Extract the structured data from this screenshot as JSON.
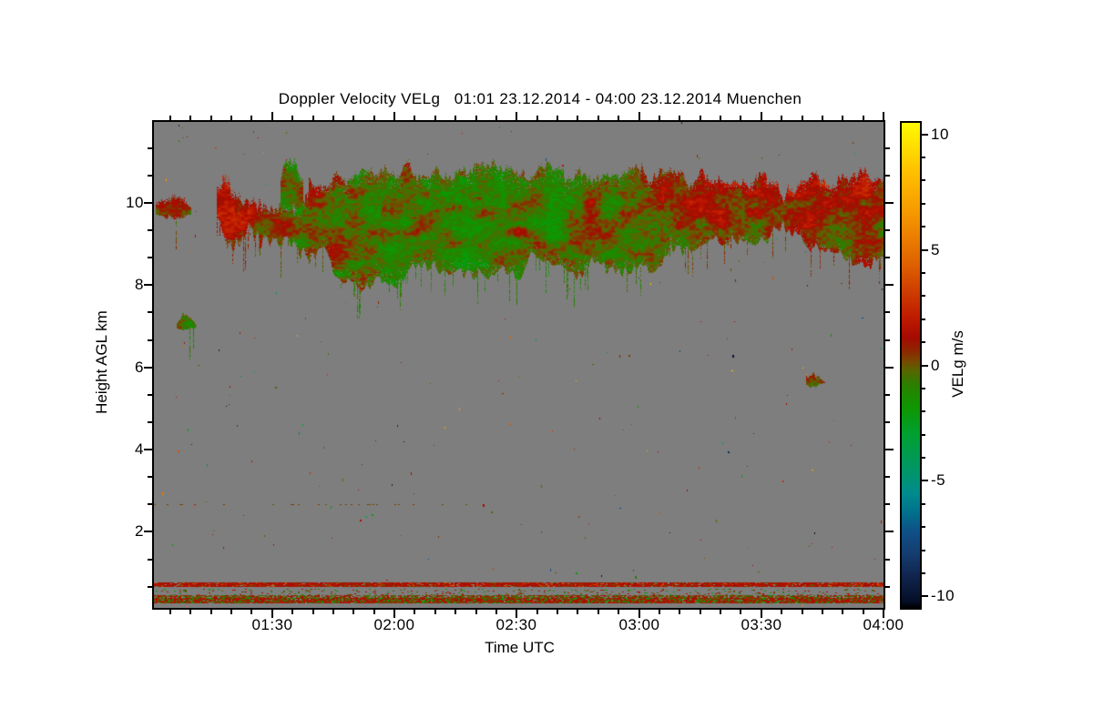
{
  "chart_data": {
    "type": "heatmap",
    "title": "Doppler Velocity VELg   01:01 23.12.2014 - 04:00 23.12.2014 Muenchen",
    "quantity": "Doppler Velocity VELg",
    "location": "Muenchen",
    "time_start": "01:01 23.12.2014",
    "time_end": "04:00 23.12.2014",
    "xlabel": "Time UTC",
    "ylabel": "Height AGL km",
    "colorbar_label": "VELg m/s",
    "x_tick_labels": [
      "01:30",
      "02:00",
      "02:30",
      "03:00",
      "03:30",
      "04:00"
    ],
    "x_tick_minutes": [
      29,
      59,
      89,
      119,
      149,
      179
    ],
    "x_minor_step_minutes": 5,
    "x_range_minutes": [
      0,
      179
    ],
    "y_tick_labels": [
      "2",
      "4",
      "6",
      "8",
      "10"
    ],
    "y_ticks_km": [
      2,
      4,
      6,
      8,
      10
    ],
    "y_minor_step_km": 0.6667,
    "ylim_km": [
      0.15,
      11.97
    ],
    "colorbar_tick_labels": [
      "10",
      "5",
      "0",
      "-5",
      "-10"
    ],
    "colorbar_ticks": [
      10,
      5,
      0,
      -5,
      -10
    ],
    "colorbar_minor_step": 1,
    "vlim_m_s": [
      -10.5,
      10.5
    ],
    "units": "m/s",
    "no_signal_color": "#7E7E7E",
    "features": [
      {
        "name": "cirrus-cloud-layer",
        "time": "01:15-04:00",
        "height_km": "8.0-11.2",
        "velocity_m_s": "-2 to +3",
        "description": "elevated cloud layer; mostly weak negative (green) Doppler velocities with olive/orange-brown patches of weak positive velocity; orange dominates after 03:10 and in the 01:20-01:45 patch"
      },
      {
        "name": "small-cloud-patch",
        "time": "01:06-01:12",
        "height_km": "6.9-7.2",
        "velocity_m_s": "about -1 (green)"
      },
      {
        "name": "small-cloud-patch",
        "time": "03:40-03:45",
        "height_km": "5.5-5.9",
        "velocity_m_s": "about -0.5 (olive-green)"
      },
      {
        "name": "near-surface-clutter-lines",
        "height_km": "0.28-0.78",
        "description": "speckled red/olive/green horizontal artifact lines spanning the full time range"
      },
      {
        "name": "faint-dotted-line",
        "height_km": "2.7",
        "time": "01:01-02:20",
        "description": "sparse olive dots"
      },
      {
        "name": "noise-speckles",
        "description": "isolated random colored pixels scattered over the no-signal gray background"
      }
    ],
    "render": {
      "seed": 7,
      "colormap": [
        [
          10.5,
          "#FFFA00"
        ],
        [
          8.5,
          "#FFC300"
        ],
        [
          6.5,
          "#F59600"
        ],
        [
          4.5,
          "#E06400"
        ],
        [
          3.0,
          "#CC3700"
        ],
        [
          2.0,
          "#BE1900"
        ],
        [
          1.2,
          "#A50A00"
        ],
        [
          0.6,
          "#8C2800"
        ],
        [
          0.2,
          "#784600"
        ],
        [
          -0.2,
          "#5A6400"
        ],
        [
          -0.8,
          "#2D7D00"
        ],
        [
          -1.8,
          "#0F9600"
        ],
        [
          -3.0,
          "#00A032"
        ],
        [
          -4.5,
          "#009664"
        ],
        [
          -5.5,
          "#008C8C"
        ],
        [
          -6.3,
          "#00738C"
        ],
        [
          -7.2,
          "#0F5087"
        ],
        [
          -8.2,
          "#143C6E"
        ],
        [
          -9.2,
          "#0F234B"
        ],
        [
          -10.2,
          "#050F28"
        ],
        [
          -10.5,
          "#000000"
        ]
      ],
      "cloud_bands": [
        {
          "name": "left-edge-streak",
          "seed": 11,
          "topn": 0.12,
          "botn": 0.12,
          "wisp": 0.02,
          "frag": 0.5,
          "spike": 0.5,
          "kp": [
            [
              0.5,
              9.92,
              9.72,
              0.5,
              0.3
            ],
            [
              3,
              9.98,
              9.62,
              0.35,
              0.3
            ],
            [
              6,
              10.05,
              9.58,
              0.5,
              0.3
            ],
            [
              9,
              9.9,
              9.7,
              0.35,
              0.3
            ]
          ]
        },
        {
          "name": "orange-patch",
          "seed": 23,
          "topn": 0.3,
          "botn": 0.35,
          "wisp": 0.05,
          "frag": 0.55,
          "spike": 0.8,
          "kp": [
            [
              15.5,
              10.15,
              9.7,
              1.5,
              0.6
            ],
            [
              17.5,
              10.5,
              9.3,
              1.7,
              0.6
            ],
            [
              19.5,
              10.35,
              9.15,
              1.4,
              0.6
            ],
            [
              21.5,
              10.2,
              9.3,
              1.1,
              0.5
            ],
            [
              23.5,
              10.05,
              9.5,
              0.9,
              0.5
            ]
          ]
        },
        {
          "name": "left-cloud",
          "seed": 37,
          "topn": 0.25,
          "botn": 0.4,
          "wisp": 0.14,
          "frag": 0.3,
          "spike": 0.7,
          "kp": [
            [
              20,
              10.0,
              9.5,
              0.8,
              0.9
            ],
            [
              23,
              10.1,
              9.2,
              0.9,
              1.0
            ],
            [
              26,
              10.05,
              8.95,
              0.45,
              0.9
            ],
            [
              29,
              9.95,
              8.8,
              0.2,
              0.8
            ],
            [
              32,
              10.05,
              8.7,
              0.0,
              0.6
            ],
            [
              35,
              9.95,
              8.65,
              -0.15,
              0.5
            ],
            [
              38,
              10.35,
              8.7,
              0.1,
              0.5
            ]
          ]
        },
        {
          "name": "green-column",
          "seed": 41,
          "topn": 0.2,
          "botn": 0.3,
          "wisp": 0.05,
          "frag": 0.4,
          "spike": 0.8,
          "kp": [
            [
              31,
              10.45,
              9.9,
              -0.5,
              0.2
            ],
            [
              33,
              10.95,
              9.55,
              -0.75,
              0.2
            ],
            [
              35,
              10.8,
              9.65,
              -0.6,
              0.2
            ],
            [
              36.5,
              10.55,
              9.8,
              -0.4,
              0.2
            ]
          ]
        },
        {
          "name": "main-layer",
          "seed": 53,
          "topn": 0.22,
          "botn": 0.3,
          "wisp": 0.09,
          "frag": 0.14,
          "spike": 0.6,
          "kp": [
            [
              38,
              10.4,
              8.75,
              0.3,
              0.6
            ],
            [
              44,
              10.55,
              8.5,
              -0.2,
              0.45
            ],
            [
              50,
              10.6,
              8.15,
              -0.55,
              0.35
            ],
            [
              57,
              10.7,
              8.1,
              -0.75,
              0.3
            ],
            [
              66,
              10.7,
              8.3,
              -0.85,
              0.25
            ],
            [
              75,
              10.75,
              8.4,
              -0.9,
              0.2
            ],
            [
              85,
              10.7,
              8.45,
              -0.75,
              0.2
            ],
            [
              95,
              10.7,
              8.5,
              -0.8,
              0.25
            ],
            [
              105,
              10.65,
              8.5,
              -0.65,
              0.3
            ],
            [
              115,
              10.7,
              8.55,
              -0.45,
              0.35
            ],
            [
              124,
              10.65,
              8.65,
              -0.1,
              0.5
            ],
            [
              132,
              10.6,
              8.8,
              0.4,
              1.05
            ],
            [
              140,
              10.6,
              9.0,
              0.55,
              1.15
            ],
            [
              147,
              10.55,
              9.3,
              0.45,
              1.05
            ],
            [
              153,
              10.4,
              9.4,
              0.3,
              1.0
            ],
            [
              154.5,
              9.95,
              9.5,
              0.3,
              1.0
            ],
            [
              155.5,
              10.45,
              9.3,
              0.55,
              1.2
            ],
            [
              158,
              10.5,
              9.2,
              0.8,
              1.3
            ],
            [
              164,
              10.55,
              8.85,
              0.85,
              1.35
            ],
            [
              170,
              10.6,
              8.6,
              0.6,
              1.2
            ],
            [
              175,
              10.65,
              8.6,
              0.7,
              1.25
            ],
            [
              179,
              10.5,
              8.6,
              0.5,
              1.2
            ]
          ]
        },
        {
          "name": "blob-7km",
          "seed": 61,
          "topn": 0.08,
          "botn": 0.08,
          "wisp": 0.02,
          "frag": 0.3,
          "spike": 0.3,
          "kp": [
            [
              5.5,
              7.12,
              6.98,
              -0.6,
              0
            ],
            [
              7,
              7.25,
              6.85,
              -0.85,
              0
            ],
            [
              9,
              7.2,
              6.9,
              -0.7,
              0
            ],
            [
              10.5,
              7.03,
              6.95,
              -0.45,
              0
            ]
          ]
        },
        {
          "name": "blob-5-7km",
          "seed": 71,
          "topn": 0.06,
          "botn": 0.06,
          "wisp": 0.02,
          "frag": 0.35,
          "spike": 0.3,
          "kp": [
            [
              160,
              5.75,
              5.63,
              -0.25,
              0.3
            ],
            [
              161.5,
              5.85,
              5.55,
              -0.45,
              0.3
            ],
            [
              163,
              5.8,
              5.58,
              -0.35,
              0.3
            ],
            [
              164.5,
              5.7,
              5.62,
              -0.2,
              0.3
            ]
          ]
        }
      ],
      "overlays": [
        {
          "t0": 56,
          "t1": 96,
          "h0": 8.9,
          "h1": 10.15,
          "amp": 2.0,
          "fx": 0.045,
          "fy": 0.075,
          "thresh": 0.52
        },
        {
          "t0": 38,
          "t1": 55,
          "h0": 8.6,
          "h1": 10.0,
          "amp": 1.3,
          "fx": 0.05,
          "fy": 0.08,
          "thresh": 0.5
        },
        {
          "t0": 96,
          "t1": 125,
          "h0": 8.8,
          "h1": 10.3,
          "amp": 1.1,
          "fx": 0.05,
          "fy": 0.08,
          "thresh": 0.55
        }
      ],
      "surface_bands": [
        {
          "h0": 0.775,
          "h1": 0.685,
          "density": 0.94,
          "mix": [
            [
              0.78,
              [
                0.9,
                1.9
              ]
            ],
            [
              0.12,
              [
                -0.3,
                0.6
              ]
            ],
            [
              0.1,
              [
                2.2,
                4.5
              ]
            ]
          ]
        },
        {
          "h0": 0.62,
          "h1": 0.47,
          "density": 0.1,
          "mix": [
            [
              0.45,
              [
                -0.4,
                0.7
              ]
            ],
            [
              0.3,
              [
                0.8,
                1.8
              ]
            ],
            [
              0.25,
              [
                -2.6,
                -0.8
              ]
            ]
          ]
        },
        {
          "h0": 0.465,
          "h1": 0.4,
          "density": 0.72,
          "mix": [
            [
              0.62,
              [
                -0.35,
                0.55
              ]
            ],
            [
              0.28,
              [
                0.8,
                1.7
              ]
            ],
            [
              0.1,
              [
                -2.2,
                -0.9
              ]
            ]
          ]
        },
        {
          "h0": 0.395,
          "h1": 0.28,
          "density": 0.96,
          "mix": [
            [
              0.58,
              [
                0.9,
                1.9
              ]
            ],
            [
              0.22,
              [
                -0.35,
                0.5
              ]
            ],
            [
              0.2,
              [
                -2.5,
                -0.9
              ]
            ]
          ]
        }
      ],
      "dotted_line": {
        "h": 2.68,
        "t0": 0,
        "t1": 78,
        "density": 0.15,
        "v": [
          -0.2,
          0.7
        ]
      },
      "specks": {
        "count": 240,
        "weights": [
          [
            0.5,
            [
              -0.7,
              1.7
            ]
          ],
          [
            0.2,
            [
              2.0,
              9.0
            ]
          ],
          [
            0.17,
            [
              -6.0,
              -1.5
            ]
          ],
          [
            0.13,
            [
              -10.3,
              -6.5
            ]
          ]
        ]
      }
    }
  }
}
